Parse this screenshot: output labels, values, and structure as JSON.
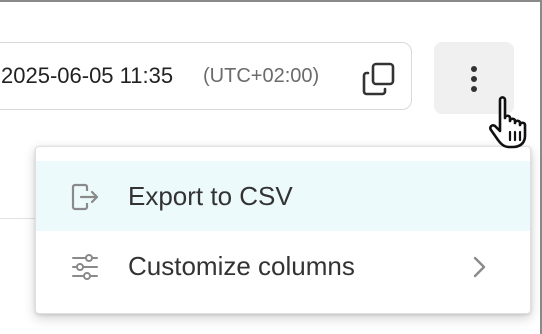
{
  "timestamp": {
    "value": "2025-06-05 11:35",
    "timezone": "(UTC+02:00)"
  },
  "icons": {
    "copy": "copy-icon",
    "more": "more-vertical-icon",
    "export": "file-export-icon",
    "customize": "sliders-icon",
    "submenu": "chevron-right-icon",
    "cursor": "hand-pointer-cursor"
  },
  "menu": {
    "items": [
      {
        "label": "Export to CSV",
        "highlighted": true
      },
      {
        "label": "Customize columns",
        "has_submenu": true
      }
    ]
  },
  "colors": {
    "highlight": "#ecfafb",
    "icon": "#8a8a8a",
    "text": "#333333",
    "button_bg": "#f0f0f0"
  }
}
